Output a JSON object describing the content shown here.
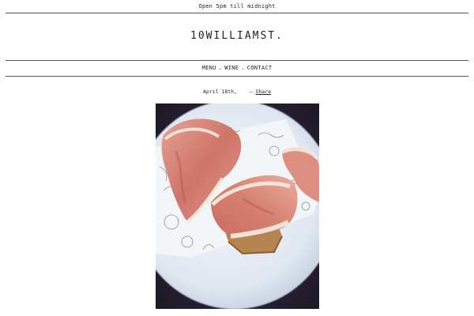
{
  "header": {
    "hours": "Open 5pm till midnight",
    "site_title": "10WILLIAMST."
  },
  "nav": {
    "items": [
      {
        "label": "MENU"
      },
      {
        "label": "WINE"
      },
      {
        "label": "CONTACT"
      }
    ],
    "separator": "."
  },
  "post": {
    "date": "April 18th,",
    "share_prefix": "—",
    "share_label": "Share",
    "photo": {
      "subject": "prosciutto-plate",
      "colors": {
        "background": "#2c2436",
        "plate": "#e8eef5",
        "meat": "#d9897f",
        "fat": "#f6ece4",
        "bread": "#b6844e"
      }
    }
  }
}
